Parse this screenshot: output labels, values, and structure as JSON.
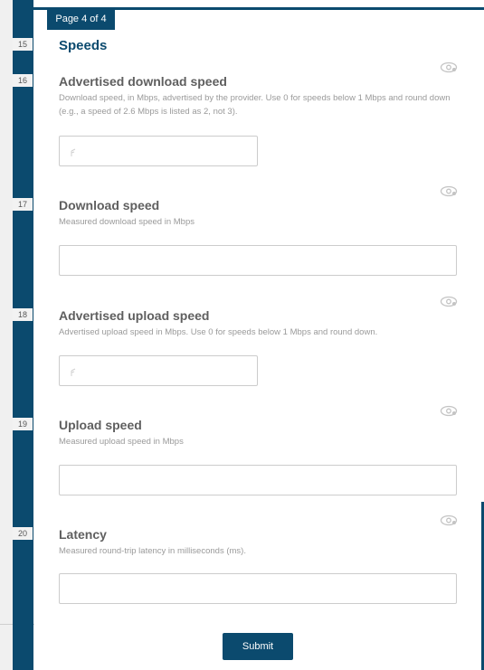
{
  "page_indicator": "Page 4 of 4",
  "section_title": "Speeds",
  "questions": [
    {
      "number": "15",
      "title": "",
      "description": "",
      "value": ""
    },
    {
      "number": "16",
      "title": "Advertised download speed",
      "description": "Download speed, in Mbps, advertised by the provider. Use 0 for speeds below 1 Mbps and round down (e.g., a speed of 2.6 Mbps is listed as 2, not 3).",
      "value": ""
    },
    {
      "number": "17",
      "title": "Download speed",
      "description": "Measured download speed in Mbps",
      "value": ""
    },
    {
      "number": "18",
      "title": "Advertised upload speed",
      "description": "Advertised upload speed in Mbps. Use 0 for speeds below 1 Mbps and round down.",
      "value": ""
    },
    {
      "number": "19",
      "title": "Upload speed",
      "description": "Measured upload speed in Mbps",
      "value": ""
    },
    {
      "number": "20",
      "title": "Latency",
      "description": "Measured round-trip latency in milliseconds (ms).",
      "value": ""
    }
  ],
  "icons": {
    "visibility": "eye-icon",
    "field_hint": "pointer-cursor-icon"
  },
  "submit_label": "Submit",
  "colors": {
    "accent": "#0b4a6e",
    "title_text": "#5f5f5f",
    "hint_text": "#9a9a9a",
    "field_border": "#cccccc"
  }
}
